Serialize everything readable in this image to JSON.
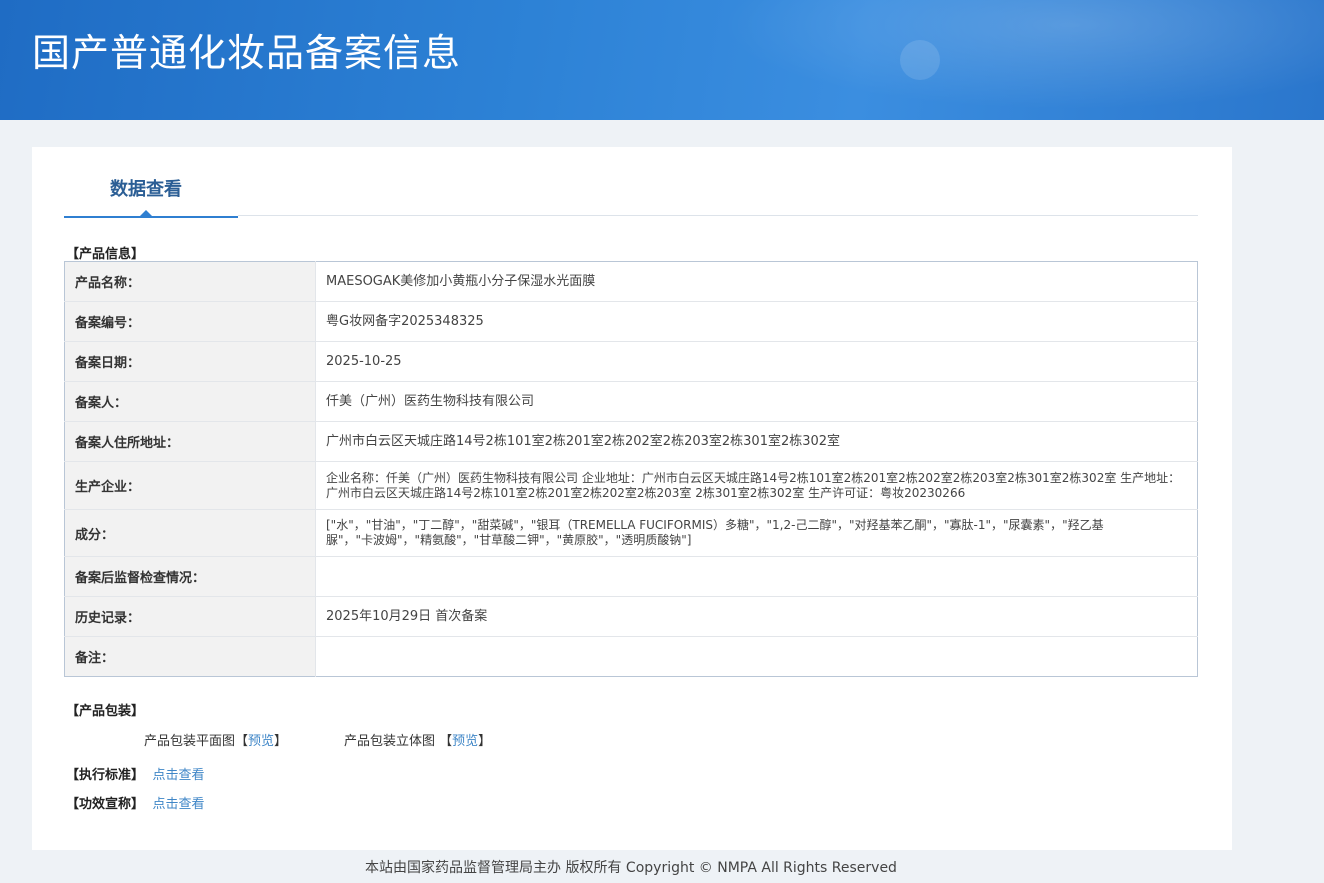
{
  "header": {
    "title": "国产普通化妆品备案信息"
  },
  "tab": {
    "label": "数据查看"
  },
  "sections": {
    "product_info": "【产品信息】",
    "packaging": "【产品包装】",
    "standard": "【执行标准】",
    "efficacy": "【功效宣称】"
  },
  "product_info_rows": [
    {
      "key": "产品名称：",
      "value": "MAESOGAK美修加小黄瓶小分子保湿水光面膜"
    },
    {
      "key": "备案编号：",
      "value": "粤G妆网备字2025348325"
    },
    {
      "key": "备案日期：",
      "value": "2025-10-25"
    },
    {
      "key": "备案人：",
      "value": "仟美（广州）医药生物科技有限公司"
    },
    {
      "key": "备案人住所地址：",
      "value": "广州市白云区天城庄路14号2栋101室2栋201室2栋202室2栋203室2栋301室2栋302室"
    },
    {
      "key": "生产企业：",
      "value": "企业名称：仟美（广州）医药生物科技有限公司 企业地址：广州市白云区天城庄路14号2栋101室2栋201室2栋202室2栋203室2栋301室2栋302室 生产地址：广州市白云区天城庄路14号2栋101室2栋201室2栋202室2栋203室 2栋301室2栋302室 生产许可证：粤妆20230266"
    },
    {
      "key": "成分：",
      "value": "[\"水\"，\"甘油\"，\"丁二醇\"，\"甜菜碱\"，\"银耳（TREMELLA FUCIFORMIS）多糖\"，\"1,2-己二醇\"，\"对羟基苯乙酮\"，\"寡肽-1\"，\"尿囊素\"，\"羟乙基脲\"，\"卡波姆\"，\"精氨酸\"，\"甘草酸二钾\"，\"黄原胶\"，\"透明质酸钠\"]"
    },
    {
      "key": "备案后监督检查情况：",
      "value": ""
    },
    {
      "key": "历史记录：",
      "value": "2025年10月29日 首次备案"
    },
    {
      "key": "备注：",
      "value": ""
    }
  ],
  "packaging": {
    "flat_label": "产品包装平面图",
    "flat_bracket_open": "【",
    "flat_link": "预览",
    "flat_bracket_close": "】",
    "stereo_label": "产品包装立体图 ",
    "stereo_bracket_open": "【",
    "stereo_link": "预览",
    "stereo_bracket_close": "】"
  },
  "standard_link": "点击查看",
  "efficacy_link": "点击查看",
  "footer": {
    "text": "本站由国家药品监督管理局主办 版权所有 Copyright © NMPA All Rights Reserved"
  }
}
